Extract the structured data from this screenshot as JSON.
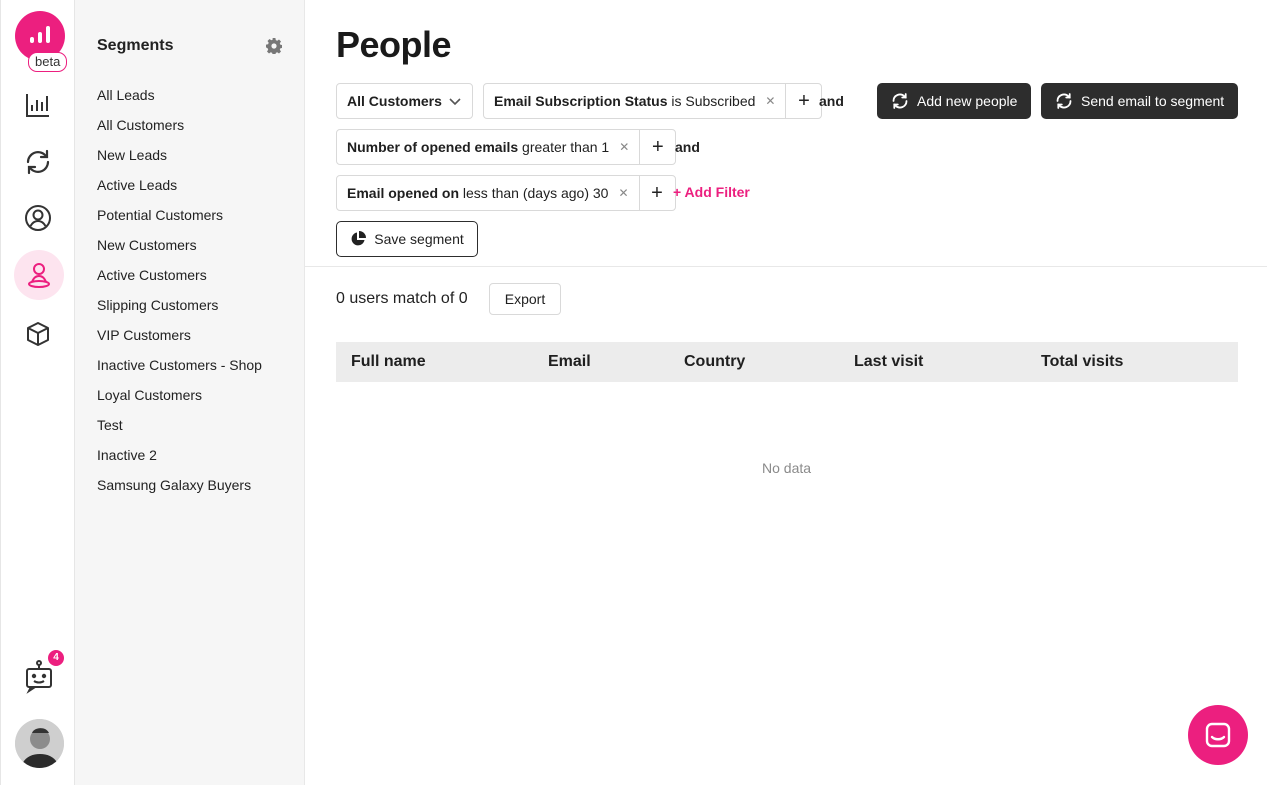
{
  "brand": {
    "accent": "#ec1f7f",
    "dark_button": "#2d2d2d",
    "badge_label": "beta"
  },
  "rail": {
    "icons": [
      "chart-icon",
      "refresh-icon",
      "user-circle-icon",
      "person-pin-icon",
      "box-icon"
    ],
    "active_icon": "person-pin-icon",
    "notification_count": "4"
  },
  "sidebar": {
    "title": "Segments",
    "items": [
      "All Leads",
      "All Customers",
      "New Leads",
      "Active Leads",
      "Potential Customers",
      "New Customers",
      "Active Customers",
      "Slipping Customers",
      "VIP Customers",
      "Inactive Customers - Shop",
      "Loyal Customers",
      "Test",
      "Inactive 2",
      "Samsung Galaxy Buyers"
    ]
  },
  "main": {
    "title": "People",
    "segment_select": "All Customers",
    "filters": [
      {
        "field": "Email Subscription Status",
        "condition": "is Subscribed"
      },
      {
        "field": "Number of opened emails",
        "condition": "greater than 1"
      },
      {
        "field": "Email opened on",
        "condition": "less than (days ago) 30"
      }
    ],
    "and_label": "and",
    "add_filter_label": "+ Add Filter",
    "add_people_label": "Add new people",
    "send_email_label": "Send email to segment",
    "save_segment_label": "Save segment",
    "match_text": "0 users match of 0",
    "export_label": "Export",
    "table": {
      "columns": [
        "Full name",
        "Email",
        "Country",
        "Last visit",
        "Total visits"
      ],
      "rows": [],
      "empty_text": "No data"
    }
  }
}
